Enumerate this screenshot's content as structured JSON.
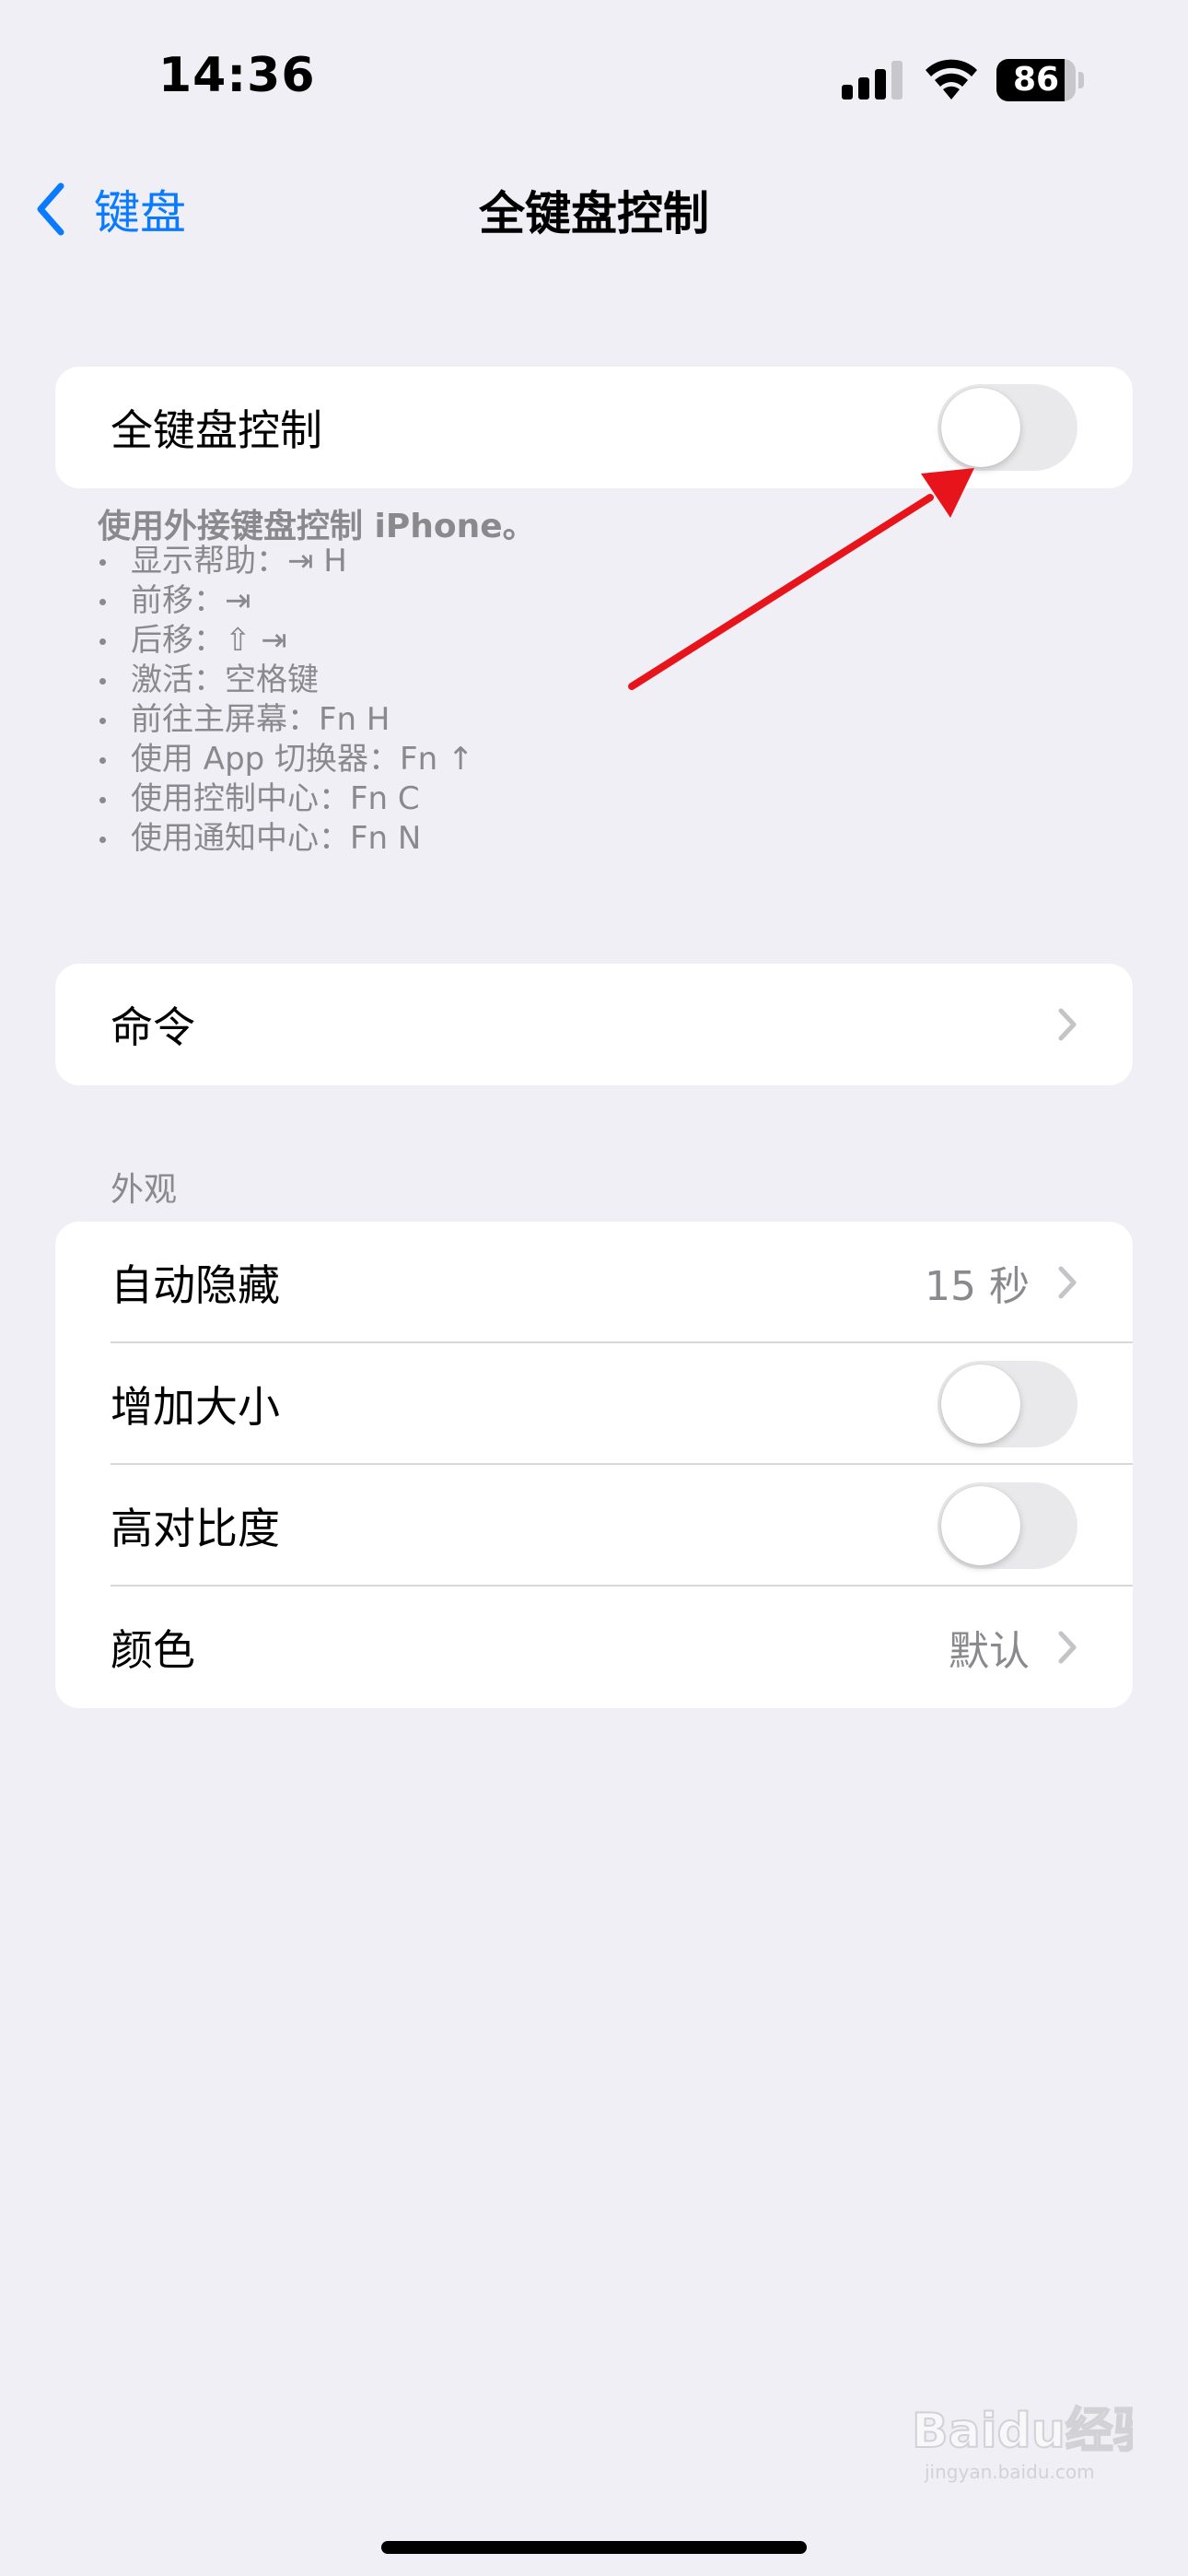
{
  "status_bar": {
    "time": "14:36",
    "battery_level": "86",
    "battery_fraction": 0.86
  },
  "nav": {
    "back_label": "键盘",
    "title": "全键盘控制"
  },
  "main_toggle": {
    "label": "全键盘控制",
    "on": false
  },
  "help": {
    "title": "使用外接键盘控制 iPhone。",
    "items": [
      "显示帮助：⇥ H",
      "前移：⇥",
      "后移：⇧ ⇥",
      "激活：空格键",
      "前往主屏幕：Fn H",
      "使用 App 切换器：Fn ↑",
      "使用控制中心：Fn C",
      "使用通知中心：Fn N"
    ]
  },
  "commands_row": {
    "label": "命令"
  },
  "appearance": {
    "header": "外观",
    "auto_hide": {
      "label": "自动隐藏",
      "value": "15 秒"
    },
    "increase_size": {
      "label": "增加大小",
      "on": false
    },
    "high_contrast": {
      "label": "高对比度",
      "on": false
    },
    "color": {
      "label": "颜色",
      "value": "默认"
    }
  },
  "colors": {
    "accent": "#0a7aff",
    "background": "#f0eff5",
    "annotation_arrow": "#e8141b"
  },
  "watermark": {
    "text": "Baidu经验",
    "subtext": "jingyan.baidu.com"
  }
}
